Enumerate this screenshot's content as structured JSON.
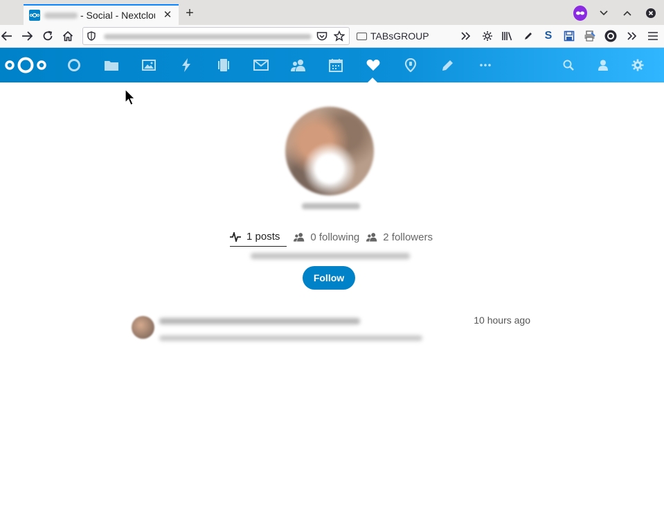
{
  "browser": {
    "tab": {
      "title": "- Social - Nextcloud",
      "close_glyph": "✕"
    },
    "new_tab_glyph": "+",
    "bookmark_folder": "TABsGROUP",
    "icons": [
      "back-icon",
      "forward-icon",
      "reload-icon",
      "home-icon",
      "shield-icon",
      "pocket-icon",
      "star-icon",
      "overflow-chevron-icon",
      "gear-icon",
      "library-icon",
      "pencil-icon",
      "s-extension-icon",
      "save-icon",
      "printer-icon",
      "circle-o-icon",
      "menu-icon"
    ]
  },
  "header": {
    "apps": [
      "dashboard",
      "files",
      "photos",
      "activity",
      "deck",
      "mail",
      "contacts",
      "calendar",
      "social",
      "maps",
      "notes",
      "more"
    ],
    "active_app": "social",
    "colors": {
      "start": "#0082c9",
      "end": "#30b6ff"
    }
  },
  "profile": {
    "stats": {
      "posts": "1 posts",
      "following": "0 following",
      "followers": "2 followers"
    },
    "follow_label": "Follow"
  },
  "timeline": {
    "posts": [
      {
        "time": "10 hours ago"
      }
    ]
  }
}
